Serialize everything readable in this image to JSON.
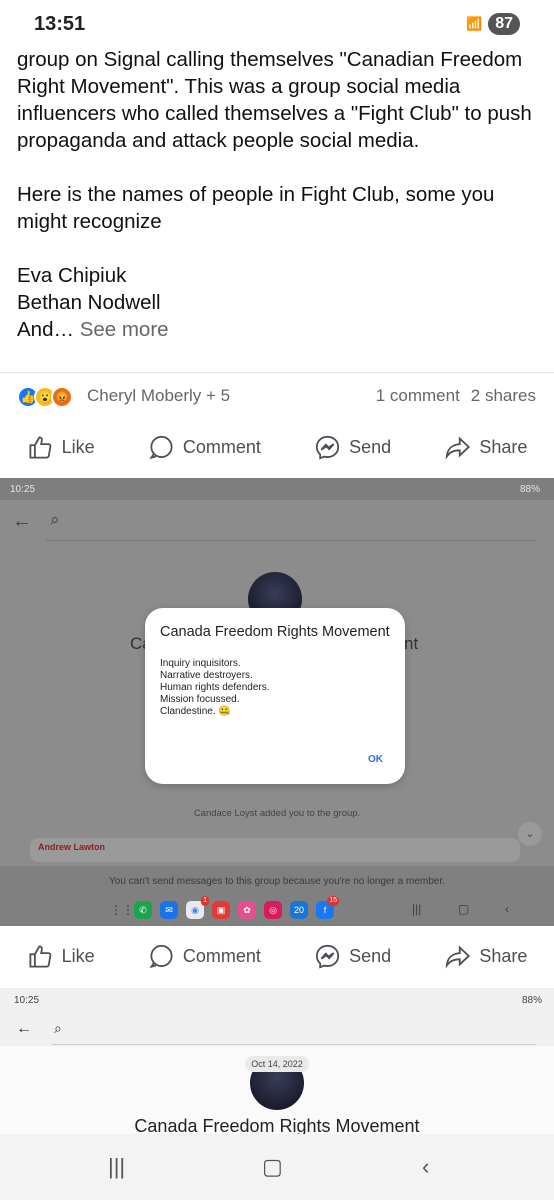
{
  "status_bar": {
    "time": "13:51",
    "battery": "87"
  },
  "post": {
    "paragraphs": [
      "group on Signal calling themselves \"Canadian Freedom Right Movement\". This was a group social media influencers who called themselves a \"Fight Club\" to push propaganda and attack people social media.",
      "Here is the names of people in Fight Club, some you might recognize",
      "Eva Chipiuk\nBethan Nodwell\nAnd…"
    ],
    "see_more": "See more"
  },
  "reactions": {
    "people": "Cheryl Moberly + 5",
    "comments": "1 comment",
    "shares": "2 shares"
  },
  "actions": {
    "like": "Like",
    "comment": "Comment",
    "send": "Send",
    "share": "Share"
  },
  "screenshot1": {
    "time": "10:25",
    "battery": "88%",
    "bg_title_left": "Ca",
    "bg_title_right": "nt",
    "dialog": {
      "title": "Canada Freedom Rights Movement",
      "lines": [
        "Inquiry inquisitors.",
        "Narrative destroyers.",
        "Human rights defenders.",
        "Mission focussed.",
        "Clandestine. 🤐"
      ],
      "ok": "OK"
    },
    "added": "Candace Loyst added you to the group.",
    "message_sender": "Andrew Lawton",
    "cannot_send": "You can't send messages to this group because you're no longer a member.",
    "dock_badges": {
      "chrome": "1",
      "facebook": "15",
      "calendar": "20"
    }
  },
  "screenshot2": {
    "time": "10:25",
    "battery": "88%",
    "date_chip": "Oct 14, 2022",
    "title": "Canada Freedom Rights Movement"
  },
  "colors": {
    "like_blue": "#1877f2",
    "muted": "#65676b",
    "link_blue": "#2d6cdf"
  }
}
